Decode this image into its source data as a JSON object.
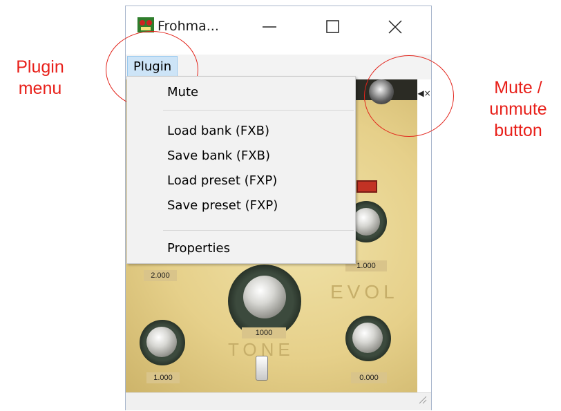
{
  "annotations": {
    "plugin_menu_label": "Plugin\nmenu",
    "mute_label": "Mute /\nunmute\nbutton",
    "color": "#e8201a"
  },
  "window": {
    "title": "Frohma...",
    "menu": {
      "plugin_label": "Plugin"
    },
    "controls": {
      "minimize": "minimize-icon",
      "maximize": "maximize-icon",
      "close": "close-icon"
    },
    "mute_button_icon": "speaker-mute-icon"
  },
  "plugin_menu": {
    "items": [
      "Mute",
      "Load bank (FXB)",
      "Save bank (FXB)",
      "Load preset (FXP)",
      "Save preset (FXP)",
      "Properties"
    ]
  },
  "plugin_panel": {
    "readouts": {
      "top_left": "2.000",
      "top_right": "1.000",
      "center": "1000",
      "bottom_left": "1.000",
      "bottom_right": "0.000"
    },
    "engravings": {
      "evol": "EVOL",
      "tone": "TONE"
    }
  }
}
